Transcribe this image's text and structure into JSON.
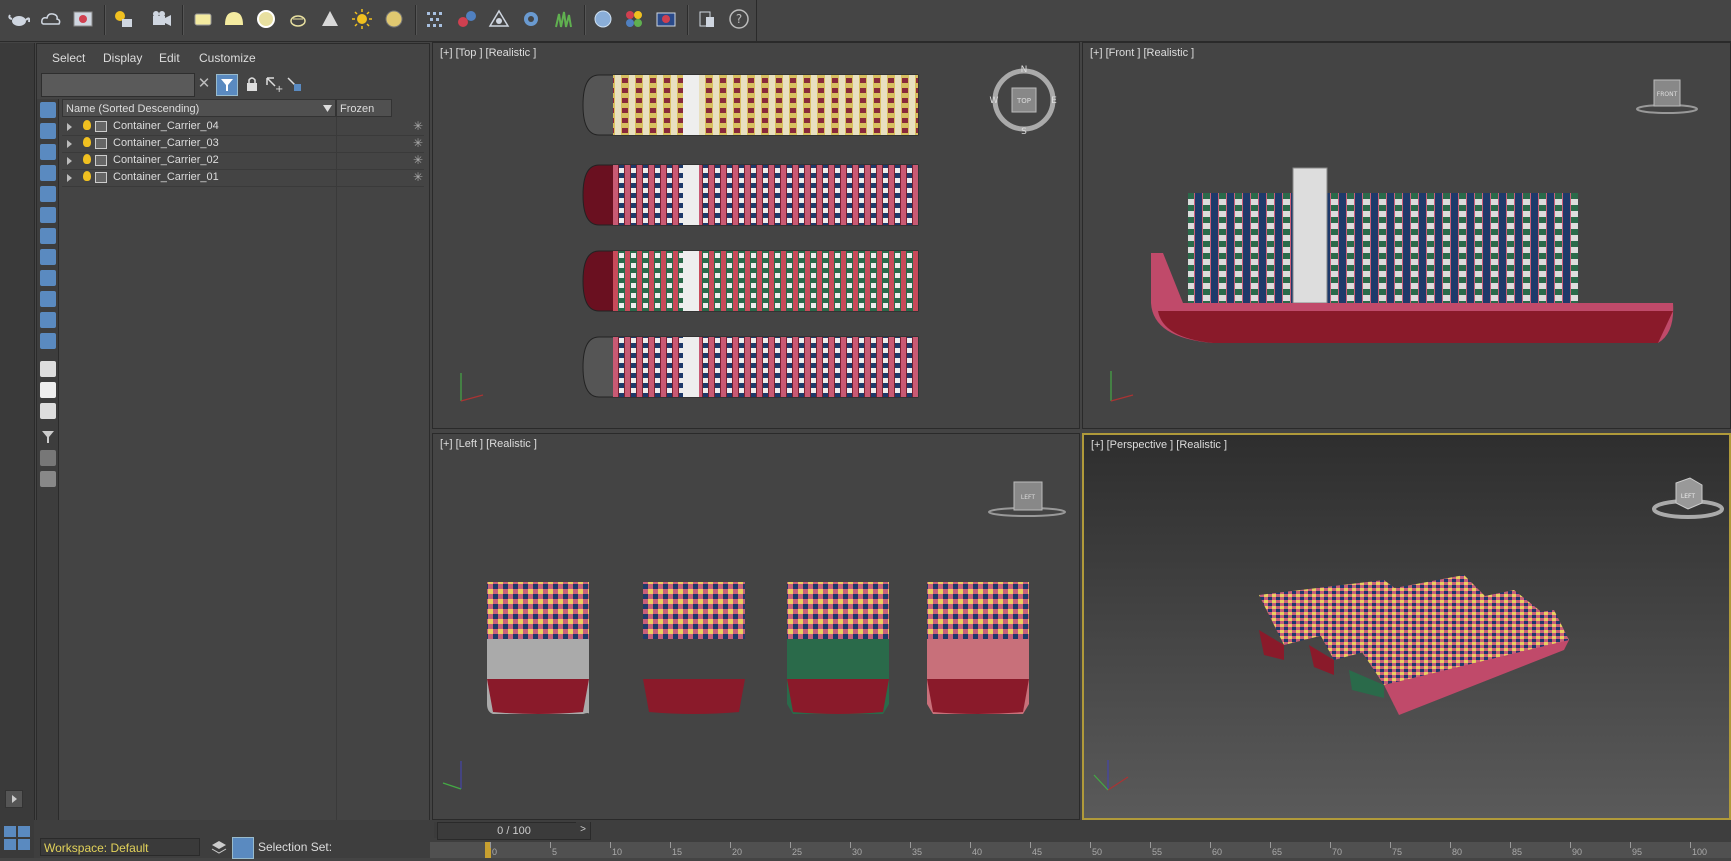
{
  "toolbar": {
    "icons": [
      "teapot-icon",
      "cloud-icon",
      "render-frame-icon",
      "light-list-icon",
      "camera-icon",
      "plane-icon",
      "dome-icon",
      "sphere-outline-icon",
      "teapot-small-icon",
      "cone-icon",
      "sun-icon",
      "disc-icon",
      "particle-icon",
      "molecule-icon",
      "rigging-icon",
      "gear-icon",
      "grass-icon",
      "globe-icon",
      "material-icon",
      "render-icon",
      "layers-icon",
      "help-icon"
    ],
    "help_label": "?"
  },
  "explorer": {
    "menu": [
      "Select",
      "Display",
      "Edit",
      "Customize"
    ],
    "search_placeholder": "",
    "columns": {
      "name": "Name (Sorted Descending)",
      "frozen": "Frozen"
    },
    "rows": [
      {
        "name": "Container_Carrier_04",
        "frozen": "✳"
      },
      {
        "name": "Container_Carrier_03",
        "frozen": "✳"
      },
      {
        "name": "Container_Carrier_02",
        "frozen": "✳"
      },
      {
        "name": "Container_Carrier_01",
        "frozen": "✳"
      }
    ],
    "clear_label": "✕"
  },
  "viewports": [
    {
      "label": "[+] [Top ] [Realistic ]",
      "view": "top",
      "gizmo_text": "TOP",
      "compass": [
        "N",
        "E",
        "S",
        "W"
      ]
    },
    {
      "label": "[+] [Front ] [Realistic ]",
      "view": "front",
      "gizmo_text": "FRONT"
    },
    {
      "label": "[+] [Left ] [Realistic ]",
      "view": "left",
      "gizmo_text": "LEFT"
    },
    {
      "label": "[+] [Perspective ] [Realistic ]",
      "view": "perspective",
      "gizmo_text": "LEFT"
    }
  ],
  "bottom": {
    "workspace": "Workspace: Default",
    "selection_set": "Selection Set:",
    "time_slider": "0 / 100",
    "timeline_ticks": [
      "0",
      "5",
      "10",
      "15",
      "20",
      "25",
      "30",
      "35",
      "40",
      "45",
      "50",
      "55",
      "60",
      "65",
      "70",
      "75",
      "80",
      "85",
      "90",
      "95",
      "100"
    ]
  },
  "colors": {
    "active_viewport_border": "#b09a3a",
    "hull_red": "#8a1a2a",
    "hull_pink": "#c8607a",
    "workspace_text": "#e2d25a"
  }
}
